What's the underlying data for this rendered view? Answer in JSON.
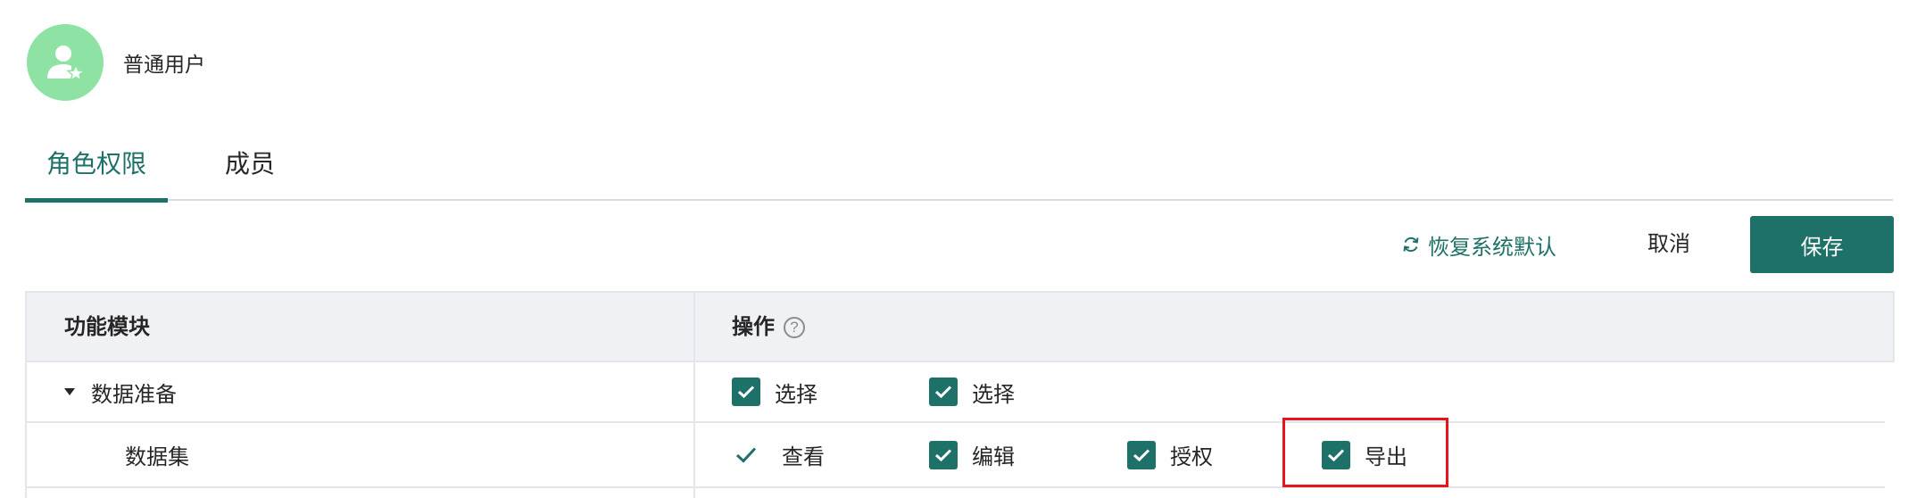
{
  "header": {
    "avatar_icon": "user-star-icon",
    "role_name": "普通用户"
  },
  "tabs": [
    {
      "label": "角色权限",
      "active": true
    },
    {
      "label": "成员",
      "active": false
    }
  ],
  "toolbar": {
    "reset_icon": "refresh-icon",
    "reset_label": "恢复系统默认",
    "cancel_label": "取消",
    "save_label": "保存"
  },
  "table": {
    "columns": [
      "功能模块",
      "操作"
    ],
    "help_icon": "question-circle-icon",
    "rows": [
      {
        "name": "数据准备",
        "expanded": true,
        "options": [
          {
            "label": "选择",
            "checked": true
          },
          {
            "label": "选择",
            "checked": true
          }
        ]
      },
      {
        "name": "数据集",
        "options": [
          {
            "label": "查看",
            "checked": true,
            "style": "plain-tick"
          },
          {
            "label": "编辑",
            "checked": true
          },
          {
            "label": "授权",
            "checked": true
          },
          {
            "label": "导出",
            "checked": true,
            "highlighted": true
          }
        ]
      }
    ]
  },
  "colors": {
    "accent": "#1e7168",
    "avatar_bg": "#8ee3a4",
    "highlight_border": "#e8131b",
    "header_bg": "#f0f1f5"
  }
}
